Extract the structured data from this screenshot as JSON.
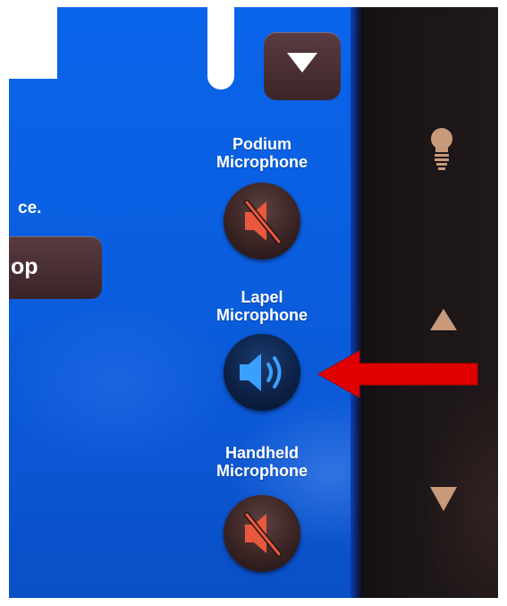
{
  "screen": {
    "partial_text": "ce.",
    "partial_button_label": "op"
  },
  "microphones": [
    {
      "line1": "Podium",
      "line2": "Microphone",
      "state": "muted",
      "icon": "speaker-muted-icon"
    },
    {
      "line1": "Lapel",
      "line2": "Microphone",
      "state": "active",
      "icon": "speaker-on-icon"
    },
    {
      "line1": "Handheld",
      "line2": "Microphone",
      "state": "muted",
      "icon": "speaker-muted-icon"
    }
  ],
  "controls": {
    "scroll_down_icon": "triangle-down-icon"
  },
  "bezel": {
    "icons": [
      "lightbulb-icon",
      "volume-up-icon",
      "volume-down-icon"
    ]
  },
  "annotation": {
    "icon": "red-arrow-icon"
  },
  "colors": {
    "screen_blue": "#0a5fe0",
    "button_brown": "#4a3033",
    "mute_icon_orange": "#e8583c",
    "speaker_icon_blue": "#3aa0ff",
    "bezel_icon": "#c89a7a",
    "arrow_red": "#e00000"
  }
}
